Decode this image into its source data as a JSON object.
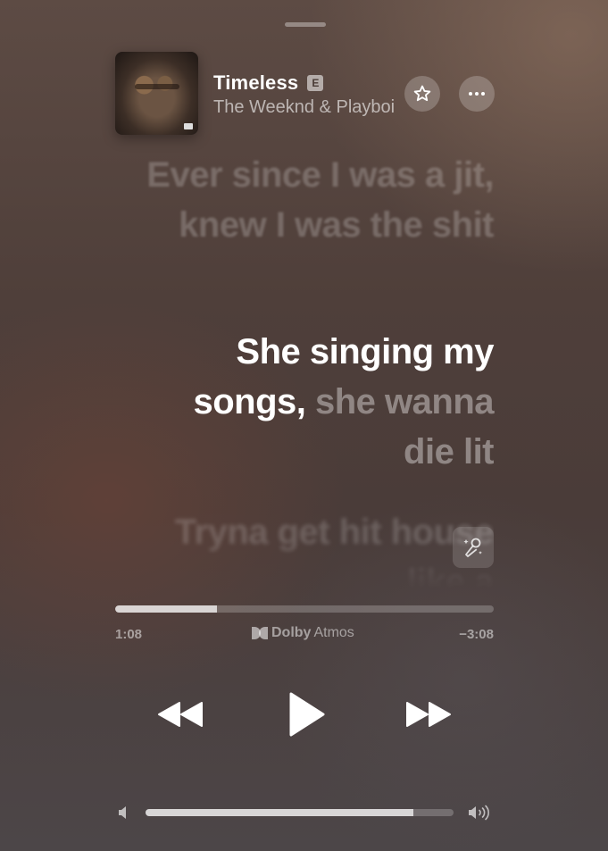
{
  "track": {
    "title": "Timeless",
    "explicit_badge": "E",
    "artist": "The Weeknd & Playboi Carti"
  },
  "icons": {
    "favorite": "star-icon",
    "more": "ellipsis-icon",
    "sing": "microphone-sparkle-icon",
    "rewind": "backward-icon",
    "play": "play-icon",
    "forward": "forward-icon",
    "volume_low": "speaker-low-icon",
    "volume_high": "speaker-high-icon"
  },
  "lyrics": {
    "previous": "Ever since I was a jit, knew I was the shit",
    "current_sung": "She singing my songs,",
    "current_upcoming": " she wanna die lit",
    "next": "Tryna get hit house like a"
  },
  "playback": {
    "elapsed": "1:08",
    "remaining": "−3:08",
    "progress_fraction": 0.27,
    "audio_format_brand": "Dolby",
    "audio_format_variant": "Atmos"
  },
  "volume": {
    "level_fraction": 0.87
  },
  "colors": {
    "accent": "#ffffff",
    "background": "#4f3f3a"
  }
}
